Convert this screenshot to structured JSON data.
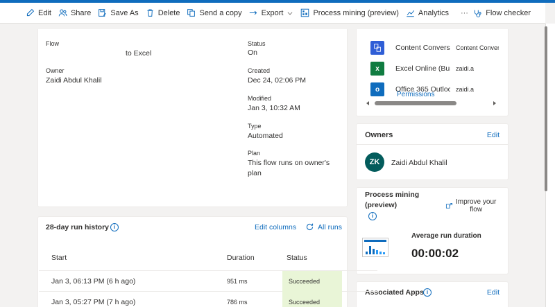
{
  "toolbar": {
    "edit": "Edit",
    "share": "Share",
    "save_as": "Save As",
    "delete": "Delete",
    "send_copy": "Send a copy",
    "export": "Export",
    "process_mining": "Process mining (preview)",
    "analytics": "Analytics",
    "more": "···",
    "flow_checker": "Flow checker"
  },
  "details": {
    "flow_label": "Flow",
    "flow_value": "to Excel",
    "owner_label": "Owner",
    "owner_value": "Zaidi Abdul Khalil",
    "status_label": "Status",
    "status_value": "On",
    "created_label": "Created",
    "created_value": "Dec 24, 02:06 PM",
    "modified_label": "Modified",
    "modified_value": "Jan 3, 10:32 AM",
    "type_label": "Type",
    "type_value": "Automated",
    "plan_label": "Plan",
    "plan_line1": "This flow runs on owner's",
    "plan_line2": "plan"
  },
  "connections": {
    "rows": [
      {
        "name": "Content Conversi",
        "account": "Content Convers"
      },
      {
        "name": "Excel Online (Busi",
        "account": "zaidi.a"
      },
      {
        "name": "Office 365 Outloc",
        "account": "zaidi.a"
      }
    ],
    "permissions": "Permissions"
  },
  "owners": {
    "title": "Owners",
    "edit": "Edit",
    "initials": "ZK",
    "name": "Zaidi Abdul Khalil"
  },
  "process_mining": {
    "title_line1": "Process mining",
    "title_line2": "(preview)",
    "improve_line1": "Improve your",
    "improve_line2": "flow",
    "avg_label": "Average run duration",
    "avg_value": "00:00:02"
  },
  "run_history": {
    "title": "28-day run history",
    "edit_columns": "Edit columns",
    "all_runs": "All runs",
    "columns": [
      "Start",
      "Duration",
      "Status"
    ],
    "rows": [
      {
        "start": "Jan 3, 06:13 PM (6 h ago)",
        "duration": "951 ms",
        "status": "Succeeded"
      },
      {
        "start": "Jan 3, 05:27 PM (7 h ago)",
        "duration": "786 ms",
        "status": "Succeeded"
      }
    ]
  },
  "associated_apps": {
    "title": "Associated Apps",
    "edit": "Edit"
  },
  "colors": {
    "accent": "#0f6cbd",
    "avatar": "#035c5c",
    "excel": "#107c41",
    "outlook": "#0f6cbd",
    "succeeded_bg": "#e9f5d7"
  }
}
